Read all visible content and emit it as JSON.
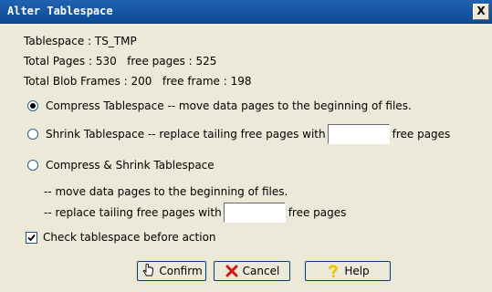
{
  "window": {
    "title": "Alter Tablespace",
    "close_label": "X"
  },
  "info": {
    "tablespace": "Tablespace : TS_TMP",
    "pages": "Total Pages : 530   free pages : 525",
    "blob": "Total Blob Frames : 200   free frame : 198"
  },
  "options": {
    "compress": "Compress Tablespace -- move data pages to the beginning of files.",
    "shrink": "Shrink Tablespace -- replace tailing free pages with",
    "shrink_suffix": "free pages",
    "shrink_value": "",
    "compress_shrink": "Compress & Shrink Tablespace",
    "cs_line1": "-- move data pages to the beginning of files.",
    "cs_line2": "-- replace tailing free pages with",
    "cs_suffix": "free pages",
    "cs_value": ""
  },
  "check": {
    "label": "Check tablespace before action",
    "checked": true
  },
  "buttons": {
    "confirm": "Confirm",
    "cancel": "Cancel",
    "help": "Help"
  },
  "icons": {
    "confirm": "hand-pointer-icon",
    "cancel": "red-x-icon",
    "help": "question-mark-icon"
  },
  "colors": {
    "titlebar": "#1f63b0",
    "dialog_bg": "#ece9d8",
    "cancel_icon": "#d01818",
    "help_icon": "#f0c000"
  }
}
